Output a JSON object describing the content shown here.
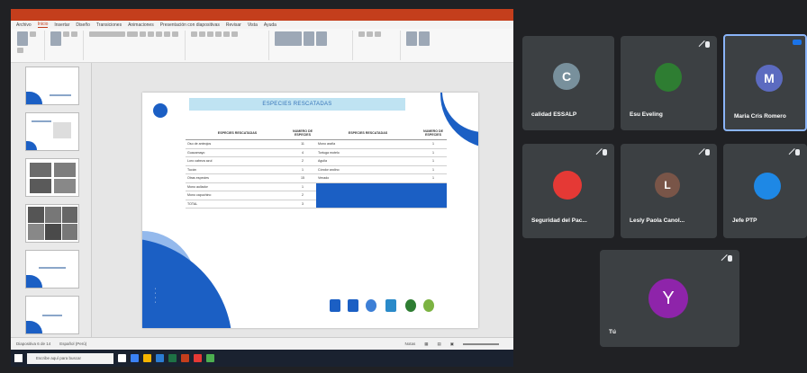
{
  "window": {
    "title": "",
    "user": "",
    "autosave": ""
  },
  "ribbon_tabs": [
    "Archivo",
    "Inicio",
    "Insertar",
    "Diseño",
    "Transiciones",
    "Animaciones",
    "Presentación con diapositivas",
    "Revisar",
    "Vista",
    "Ayuda"
  ],
  "slide": {
    "banner": "ESPECIES RESCATADAS",
    "logo_caption": "",
    "table_headers": [
      "ESPECIES RESCATADAS",
      "NUMERO DE ESPECIES",
      "ESPECIES RESCATADAS",
      "NUMERO DE ESPECIES"
    ],
    "rows": [
      {
        "a": "Oso de anteojos",
        "b": "11",
        "c": "Mono araña",
        "d": "1"
      },
      {
        "a": "Guacamayo",
        "b": "4",
        "c": "Tortuga motelo",
        "d": "1"
      },
      {
        "a": "Loro cabeza azul",
        "b": "2",
        "c": "Aguila",
        "d": "1"
      },
      {
        "a": "Tucán",
        "b": "1",
        "c": "Cóndor andino",
        "d": "1"
      },
      {
        "a": "Otras especies",
        "b": "15",
        "c": "Venado",
        "d": "1"
      },
      {
        "a": "Mono aullador",
        "b": "1",
        "c": "",
        "d": ""
      },
      {
        "a": "Mono capuchino",
        "b": "2",
        "c": "",
        "d": ""
      },
      {
        "a": "TOTAL",
        "b": "3",
        "c": "",
        "d": ""
      }
    ],
    "highlight_text": ""
  },
  "status": {
    "slide_counter": "Diapositiva 6 de 14",
    "language": "Español (Perú)",
    "notes": "Notas",
    "zoom": ""
  },
  "taskbar": {
    "search_placeholder": "Escribe aquí para buscar",
    "tray": ""
  },
  "participants": [
    {
      "name": "calidad ESSALP",
      "initial": "C",
      "color": "#78909c"
    },
    {
      "name": "Esu Eveling",
      "initial": "",
      "color": "#2e7d32"
    },
    {
      "name": "Maria Cris Romero",
      "initial": "M",
      "color": "#5c6bc0"
    },
    {
      "name": "Seguridad del Pac...",
      "initial": "",
      "color": "#e53935"
    },
    {
      "name": "Lesly Paola Canol...",
      "initial": "L",
      "color": "#795548"
    },
    {
      "name": "Jefe PTP",
      "initial": "",
      "color": "#1e88e5"
    },
    {
      "name": "Tú",
      "initial": "Y",
      "color": "#8e24aa"
    }
  ]
}
